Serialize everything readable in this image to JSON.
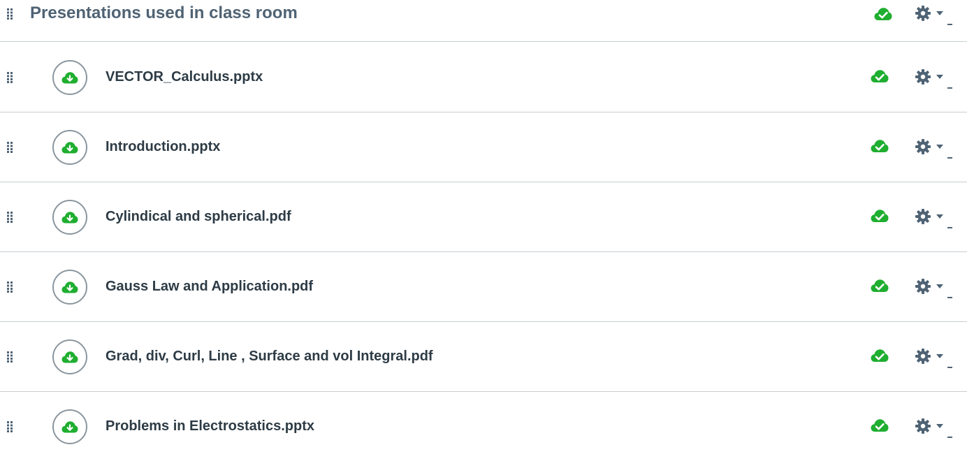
{
  "module": {
    "title": "Presentations used in class room",
    "published": true
  },
  "items": [
    {
      "title": "VECTOR_Calculus.pptx",
      "icon": "cloud-download-icon",
      "published": true
    },
    {
      "title": "Introduction.pptx",
      "icon": "cloud-download-icon",
      "published": true
    },
    {
      "title": "Cylindical and spherical.pdf",
      "icon": "cloud-download-icon",
      "published": true
    },
    {
      "title": "Gauss Law and Application.pdf",
      "icon": "cloud-download-icon",
      "published": true
    },
    {
      "title": "Grad, div, Curl, Line , Surface and vol Integral.pdf",
      "icon": "cloud-download-icon",
      "published": true
    },
    {
      "title": "Problems in Electrostatics.pptx",
      "icon": "cloud-download-icon",
      "published": true
    }
  ],
  "colors": {
    "published_green": "#1fae30",
    "title_gray": "#4f6374",
    "text_dark": "#2d3b45",
    "divider": "#c7cdd1",
    "icon_border": "#8b969e"
  }
}
